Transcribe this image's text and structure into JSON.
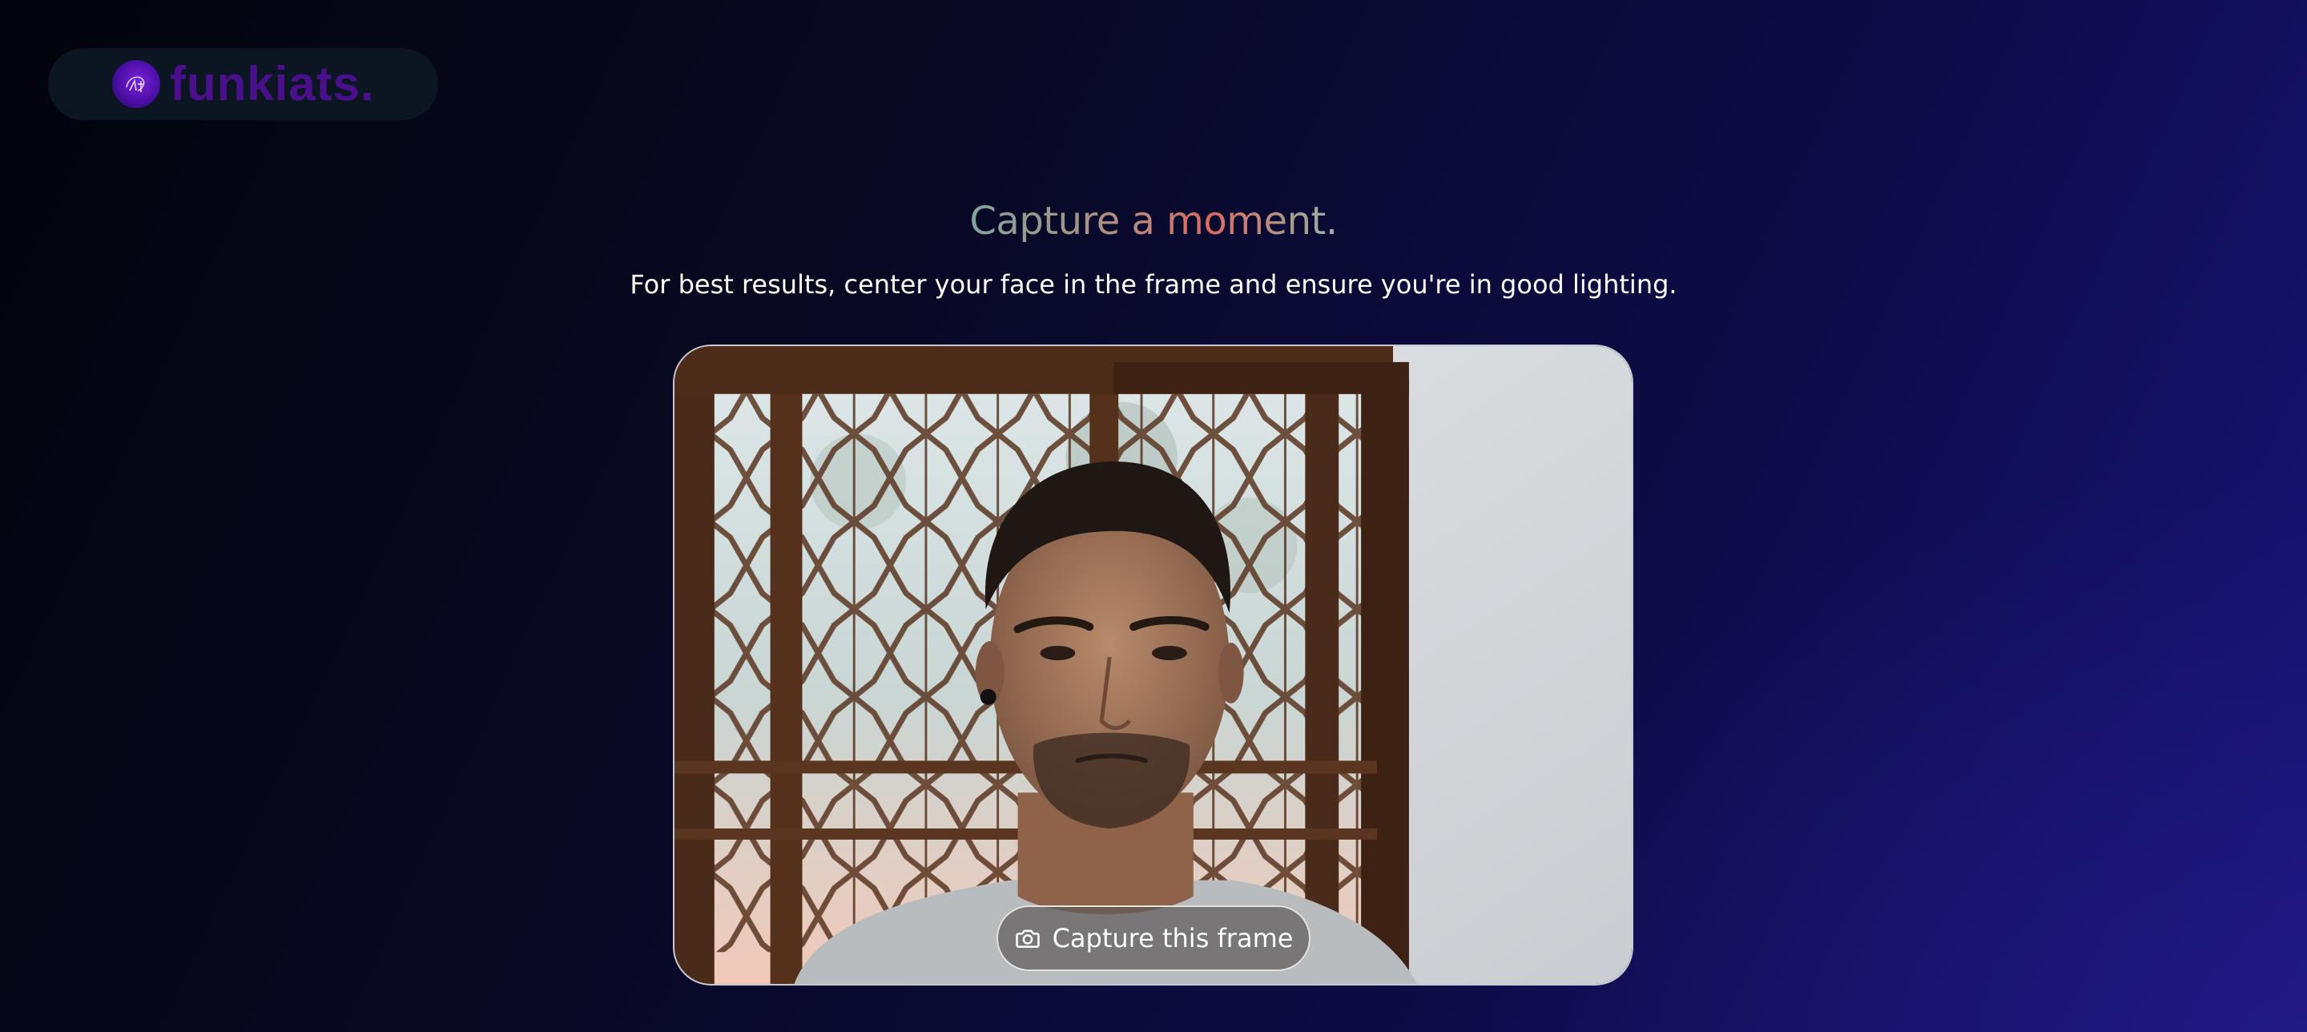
{
  "brand": {
    "name": "funkiats.",
    "logo_icon": "hand-sketch-logo-icon"
  },
  "hero": {
    "title": "Capture a moment.",
    "subtitle": "For best results, center your face in the frame and ensure you're in good lighting."
  },
  "camera": {
    "preview": "webcam-preview",
    "capture_label": "Capture this frame",
    "capture_icon": "camera-icon"
  },
  "colors": {
    "background_dark": "#04040d",
    "background_accent": "#17147a",
    "brand_text": "#4a0f8a",
    "title_gradient_start": "#7fa59a",
    "title_gradient_end": "#dc6a5e"
  }
}
